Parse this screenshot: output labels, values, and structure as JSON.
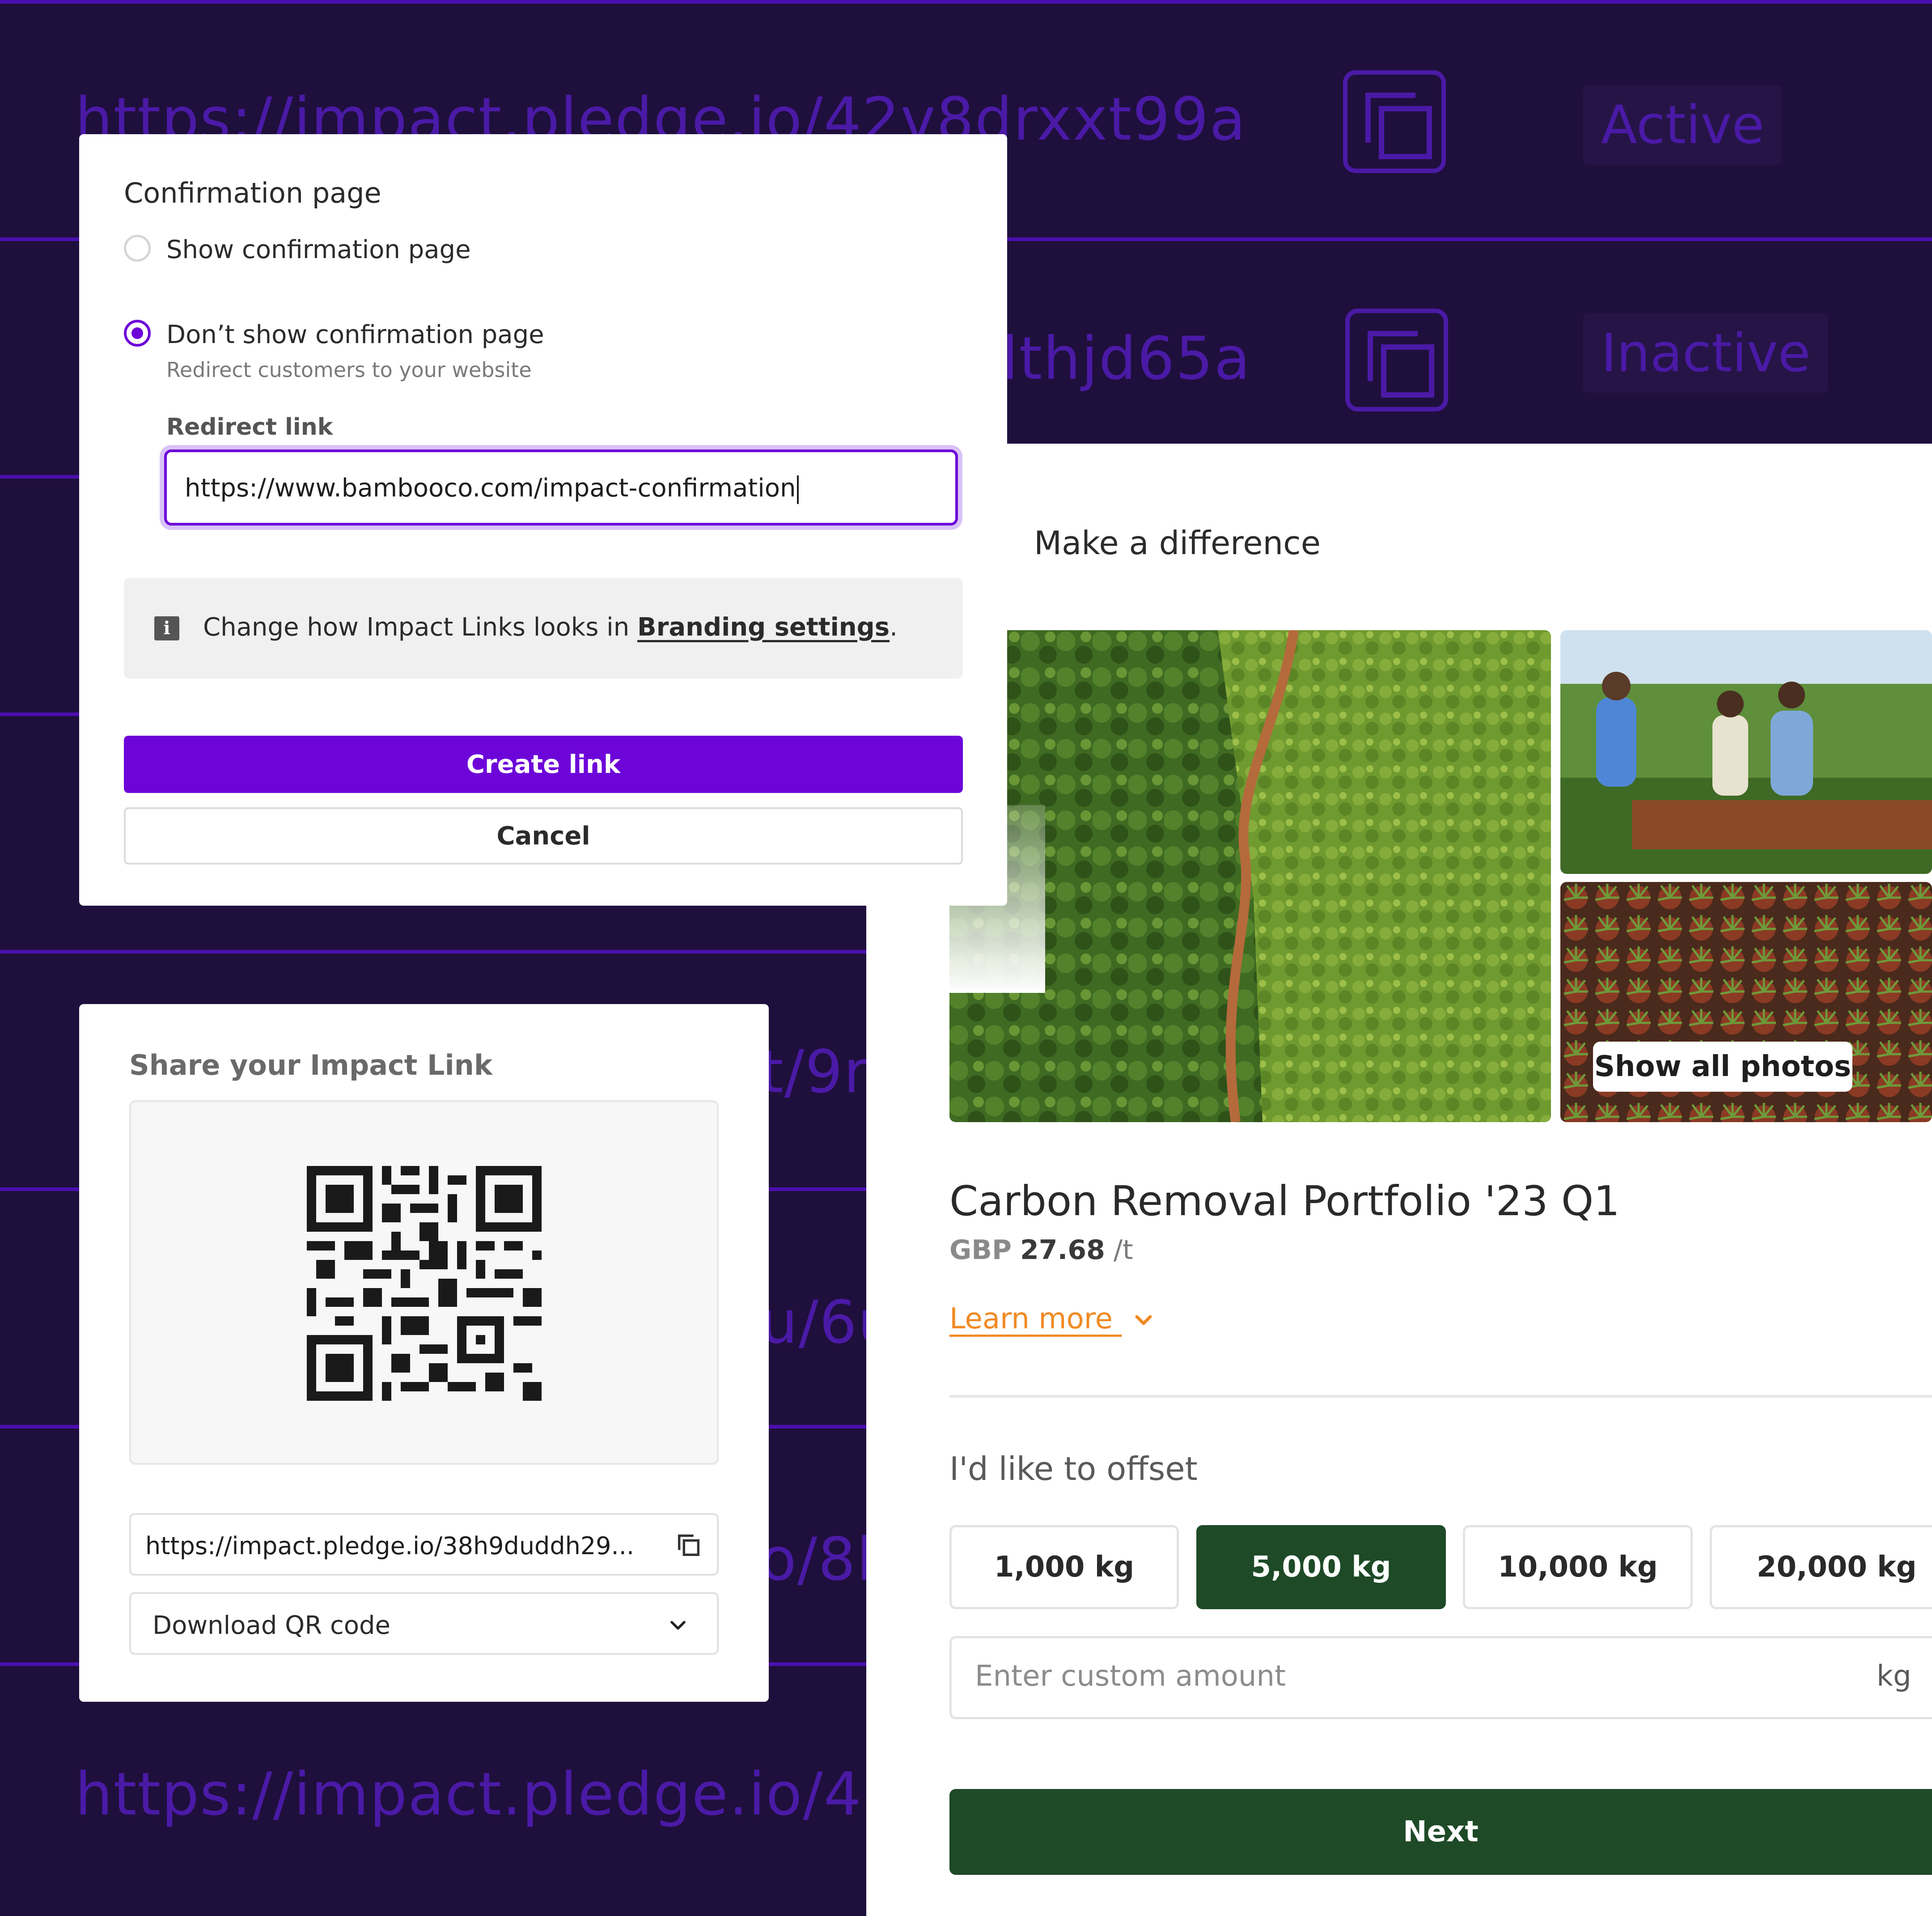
{
  "background": {
    "rows": [
      {
        "url": "https://impact.pledge.io/42v8drxxt99a",
        "status": "Active"
      },
      {
        "url": "https://impact.pledge.io/4thjd65a",
        "status": "Inactive"
      },
      {
        "url": "https://impact.pledge.io/9r",
        "status": ""
      },
      {
        "url": "https://impact.pledge.io/6u",
        "status": ""
      },
      {
        "url": "https://impact.pledge.io/8l",
        "status": ""
      },
      {
        "url": "https://impact.pledge.io/4",
        "status": ""
      }
    ],
    "visible_fragments": {
      "row1": "https://impact.pledge.io/42v8drxxt99a",
      "row1_status": "Active",
      "row2": "lthjd65a",
      "row2_status": "Inactive",
      "row3": "t/9r",
      "row4": "u/6u",
      "row5": "o/8l",
      "row6": "https://impact.pledge.io/4"
    }
  },
  "confirmation": {
    "section_title": "Confirmation page",
    "option_show": "Show confirmation page",
    "option_dont_show": "Don’t show confirmation page",
    "option_dont_show_hint": "Redirect customers to your website",
    "redirect_label": "Redirect link",
    "redirect_value": "https://www.bambooco.com/impact-confirmation",
    "info_text": "Change how Impact Links looks in ",
    "info_link": "Branding settings",
    "info_suffix": ".",
    "create_button": "Create link",
    "cancel_button": "Cancel",
    "accent": "#6d05d9"
  },
  "share": {
    "title": "Share your Impact Link",
    "link_value": "https://impact.pledge.io/38h9duddh29...",
    "download_label": "Download QR code"
  },
  "product": {
    "heading": "Make a difference",
    "show_photos_button": "Show all photos",
    "title": "Carbon Removal Portfolio '23 Q1",
    "currency": "GBP",
    "price": "27.68",
    "unit": "/t",
    "learn_more": "Learn more",
    "offset_label": "I'd like to offset",
    "amounts": [
      {
        "label": "1,000 kg",
        "selected": false
      },
      {
        "label": "5,000 kg",
        "selected": true
      },
      {
        "label": "10,000 kg",
        "selected": false
      },
      {
        "label": "20,000 kg",
        "selected": false
      }
    ],
    "custom_placeholder": "Enter custom amount",
    "custom_unit": "kg",
    "next_button": "Next",
    "accent_green": "#1e4a27",
    "link_orange": "#f08a24"
  }
}
